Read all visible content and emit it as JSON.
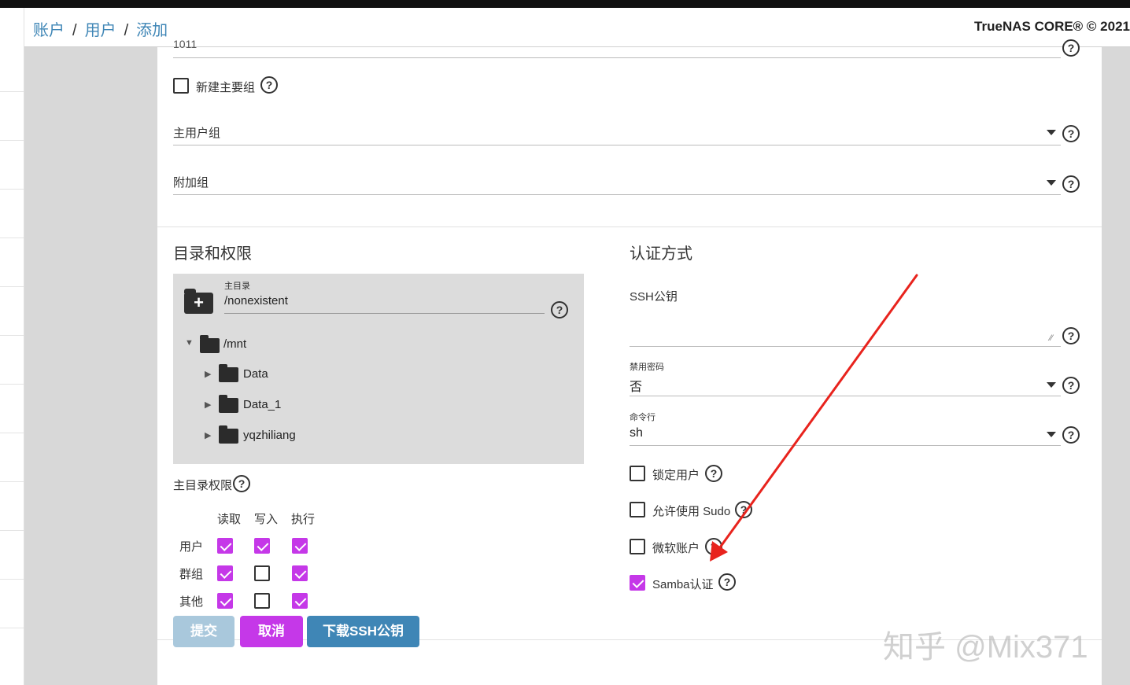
{
  "breadcrumb": {
    "item1": "账户",
    "item2": "用户",
    "item3": "添加",
    "sep": "/"
  },
  "copyright": "TrueNAS CORE® © 2021",
  "form": {
    "top_cut_value": "1011",
    "new_primary_group": {
      "label": "新建主要组",
      "checked": false
    },
    "primary_group": {
      "label": "主用户组"
    },
    "aux_groups": {
      "label": "附加组"
    },
    "help_glyph": "?"
  },
  "dir_section": {
    "title": "目录和权限",
    "home_dir": {
      "label": "主目录",
      "value": "/nonexistent"
    },
    "tree": {
      "root": "/mnt",
      "children": [
        "Data",
        "Data_1",
        "yqzhiliang"
      ]
    },
    "permissions": {
      "label": "主目录权限",
      "columns": [
        "读取",
        "写入",
        "执行"
      ],
      "rows": [
        {
          "name": "用户",
          "values": [
            true,
            true,
            true
          ]
        },
        {
          "name": "群组",
          "values": [
            true,
            false,
            true
          ]
        },
        {
          "name": "其他",
          "values": [
            true,
            false,
            true
          ]
        }
      ]
    }
  },
  "auth_section": {
    "title": "认证方式",
    "ssh_key": {
      "label": "SSH公钥"
    },
    "disable_password": {
      "label": "禁用密码",
      "value": "否"
    },
    "shell": {
      "label": "命令行",
      "value": "sh"
    },
    "lock_user": {
      "label": "锁定用户",
      "checked": false
    },
    "allow_sudo": {
      "label": "允许使用 Sudo",
      "checked": false
    },
    "microsoft_account": {
      "label": "微软账户",
      "checked": false
    },
    "samba_auth": {
      "label": "Samba认证",
      "checked": true
    }
  },
  "buttons": {
    "submit": "提交",
    "cancel": "取消",
    "download_ssh": "下载SSH公钥"
  },
  "colors": {
    "accent": "#c538e8",
    "link": "#3f86b6",
    "submit_disabled": "#a9c8dc",
    "secondary_btn": "#3f86b6",
    "annotation_arrow": "#e8231d"
  },
  "watermark": "知乎 @Mix371"
}
